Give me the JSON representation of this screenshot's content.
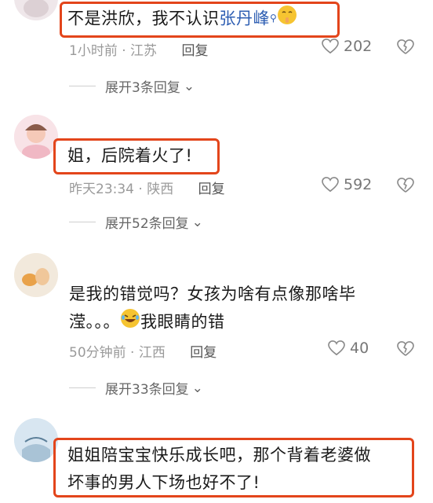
{
  "comments": [
    {
      "text_before": "不是洪欣，我不认识",
      "link_text": "张丹峰",
      "meta_time": "1小时前",
      "meta_loc": "江苏",
      "reply_label": "回复",
      "likes": "202",
      "expand_label": "展开3条回复"
    },
    {
      "text": "姐，后院着火了!",
      "meta_time": "昨天23:34",
      "meta_loc": "陕西",
      "reply_label": "回复",
      "likes": "592",
      "expand_label": "展开52条回复"
    },
    {
      "line1": "是我的错觉吗？女孩为啥有点像那啥毕",
      "line2_before": "滢。。。",
      "line2_after": "我眼睛的错",
      "meta_time": "50分钟前",
      "meta_loc": "江西",
      "reply_label": "回复",
      "likes": "40",
      "expand_label": "展开33条回复"
    },
    {
      "line1": "姐姐陪宝宝快乐成长吧，那个背着老婆做",
      "line2": "坏事的男人下场也好不了!"
    }
  ],
  "colors": {
    "highlight": "#e3451b",
    "link": "#2f5fb3"
  }
}
